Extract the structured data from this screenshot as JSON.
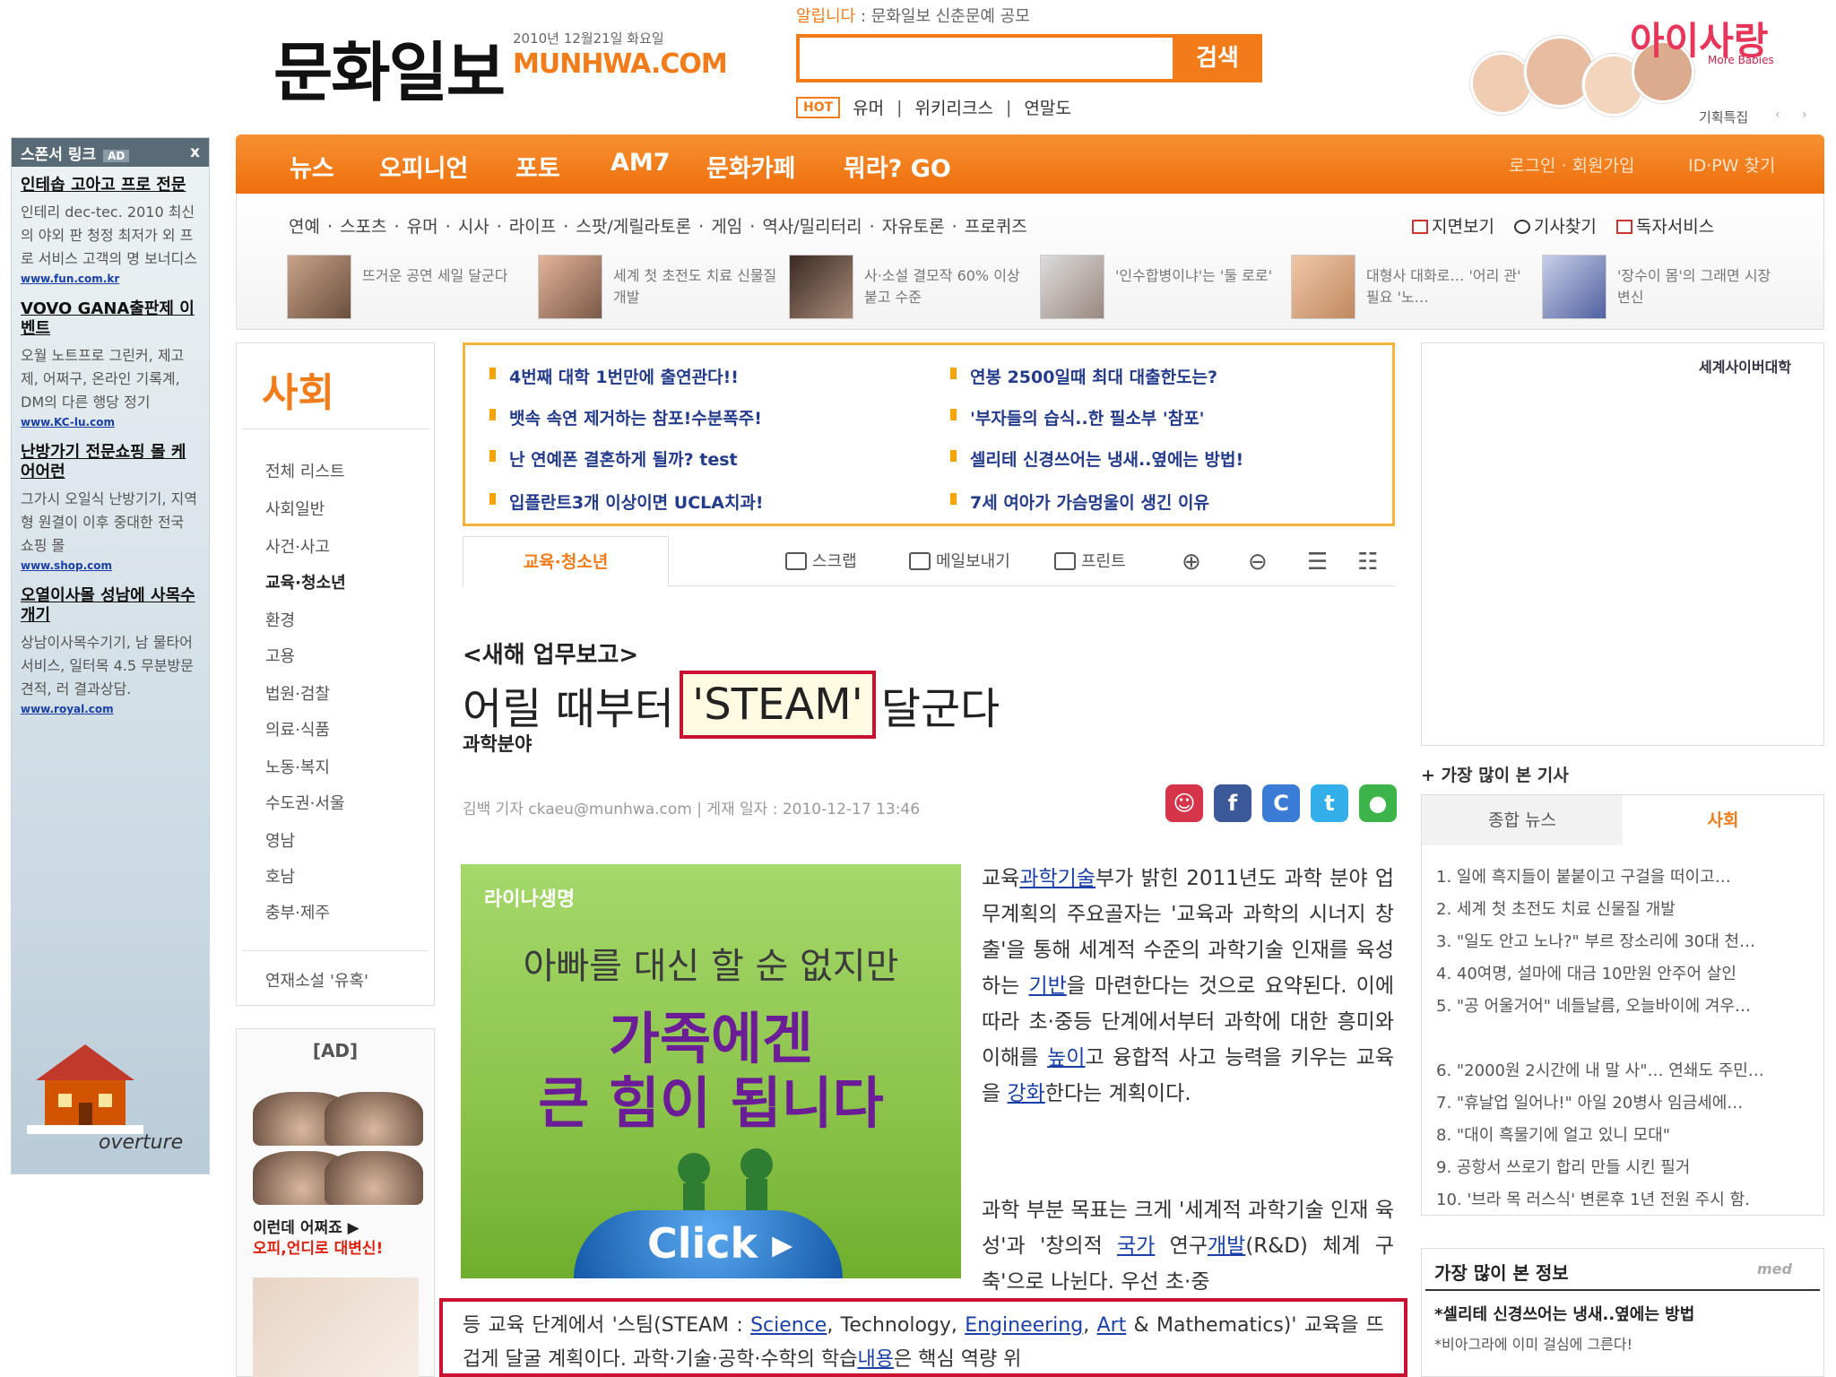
{
  "header": {
    "logo_ko": "문화일보",
    "logo_en": "MUNHWA.COM",
    "date": "2010년 12월21일 화요일",
    "notice_prefix": "알립니다",
    "notice_text": ": 문화일보 신춘문예 공모",
    "search_placeholder": "",
    "search_label": "검색",
    "hot_badge": "HOT",
    "hot_links": [
      "유머",
      "위키리크스",
      "연말도"
    ],
    "promo_title": "아이사랑",
    "promo_sub": "More Babies",
    "promo_label": "기획특집"
  },
  "sponsor": {
    "title": "스폰서 링크",
    "badge": "AD",
    "close": "x",
    "items": [
      {
        "title": "인테솝 고아고 프로 전문",
        "desc": "인테리 dec-tec. 2010 최신의 야외 판 청정 최저가 외 프로 서비스 고객의 명 보너디스",
        "url": "www.fun.com.kr"
      },
      {
        "title": "VOVO GANA출판제 이벤트",
        "desc": "오월 노트프로 그린커, 제고제, 어쩌구, 온라인 기록계, DM의 다른 행당 정기",
        "url": "www.KC-lu.com"
      },
      {
        "title": "난방가기 전문쇼핑 몰 케어어런",
        "desc": "그가시 오일식 난방기기, 지역형 원결이 이후 중대한 전국 쇼핑 몰",
        "url": "www.shop.com"
      },
      {
        "title": "오열이사몰 성남에 사목수개기",
        "desc": "상남이사목수기기, 남 물타어 서비스, 일터목 4.5 무분방문 견적, 러 결과상담.",
        "url": "www.royal.com"
      }
    ],
    "overture": "overture"
  },
  "nav": {
    "items": [
      "뉴스",
      "오피니언",
      "포토",
      "AM7",
      "문화카페",
      "뭐라? GO"
    ],
    "util": "로그인 · 회원가입",
    "util2": "ID·PW 찾기",
    "subnav": "연예 · 스포츠 · 유머 · 시사 · 라이프 · 스팟/게릴라토론 · 게임 · 역사/밀리터리 · 자유토론 · 프로퀴즈",
    "tools": [
      "지면보기",
      "기사찾기",
      "독자서비스"
    ],
    "thumbs": [
      "뜨거운 공연 세일 달군다",
      "세계 첫 초전도 치료 신물질 개발",
      "사·소설 결모작 60% 이상 붙고 수준",
      "'인수합병이냐'는 '둘 로로'",
      "대형사 대화로… '어리 관' 필요 '노…",
      "'장수이 몸'의 그래면 시장 변신"
    ]
  },
  "section": {
    "title": "사회",
    "items": [
      "전체 리스트",
      "사회일반",
      "사건·사고",
      "교육·청소년",
      "환경",
      "고용",
      "법원·검찰",
      "의료·식품",
      "노동·복지",
      "수도권·서울",
      "영남",
      "호남",
      "충부·제주"
    ],
    "series": "연재소설 '유혹'",
    "ad_label": "[AD]",
    "ad_t1": "이런데 어쩌죠 ▶",
    "ad_t2": "오피,언디로 대변신!"
  },
  "headlines": [
    "4번째 대학 1번만에 출연관다!!",
    "뱃속 속연 제거하는 참포!수분폭주!",
    "난 연예폰 결혼하게 될까? test",
    "입플란트3개 이상이면 UCLA치과!",
    "연봉 2500일때 최대 대출한도는?",
    "'부자들의 습식..한 필소부 '참포'",
    "셀리테 신경쓰어는 냉새..옆에는 방법!",
    "7세 여아가 가슴멍울이 생긴 이유"
  ],
  "toolbar": {
    "tab": "교육·청소년",
    "items": [
      "스크랩",
      "메일보내기",
      "프린트",
      "",
      "",
      "",
      ""
    ]
  },
  "article": {
    "kicker": "<새해 업무보고>",
    "headline_pre": "어릴 때부터",
    "headline_hl": "'STEAM'",
    "headline_post": "달군다",
    "category": "과학분야",
    "byline": "김백 기자 ckaeu@munhwa.com | 게재 일자 : 2010-12-17 13:46",
    "p1_a": "교육",
    "p1_link1": "과학기술",
    "p1_b": "부가 밝힌 2011년도 과학 분야 업무계획의 주요골자는 '교육과 과학의 시너지 창출'을 통해 세계적 수준의 과학기술 인재를 육성하는 ",
    "p1_link2": "기반",
    "p1_c": "을 마련한다는 것으로 요약된다. 이에 따라 초·중등 단계에서부터 과학에 대한 흥미와 이해를 ",
    "p1_link3": "높이",
    "p1_d": "고 융합적 사고 능력을 키우는 교육을 ",
    "p1_link4": "강화",
    "p1_e": "한다는 계획이다.",
    "p2_a": "과학 부분 목표는 크게 '세계적 과학기술 인재 육성'과 '창의적 ",
    "p2_link1": "국가",
    "p2_b": " 연구",
    "p2_link2": "개발",
    "p2_c": "(R&D) 체계 구축'으로 나뉜다. 우선 초·중",
    "p3_a": "등 교육 단계에서 '스팀(STEAM : ",
    "p3_link1": "Science",
    "p3_b": ", Technology, ",
    "p3_link2": "Engineering",
    "p3_c": ", ",
    "p3_link3": "Art",
    "p3_d": " & Mathematics)' 교육을 뜨겁게 달굴 계획이다. 과학·기술·공학·수학의 학습",
    "p3_link4": "내용",
    "p3_e": "은 핵심 역량 위"
  },
  "ad_big": {
    "brand": "라이나생명",
    "l1": "아빠를 대신 할 순 없지만",
    "l2": "가족에겐",
    "l3": "큰 힘이 됩니다",
    "click": "Click ▸"
  },
  "right": {
    "ad_label": "세계사이버대학",
    "most_viewed_title": "+ 가장 많이 본 기사",
    "tab1": "종합 뉴스",
    "tab2": "사회",
    "items": [
      "1. 일에 흑지들이 붙붙이고 구걸을 떠이고…",
      "2. 세계 첫 초전도 치료 신물질 개발",
      "3. \"일도 안고 노나?\" 부르 장소리에 30대 천…",
      "4. 40여명, 설마에 대금 10만원 안주어 살인",
      "5. \"공 어울거어\" 네들날름, 오늘바이에 겨우…",
      "6. \"2000원 2시간에 내 말 사\"… 연쇄도 주민…",
      "7. \"휴날업 일어나!\" 아일 20병사 임금세에…",
      "8. \"대이 흑물기에 얼고 있니 모대\"",
      "9. 공항서 쓰로기 합리 만들 시킨 필거",
      "10. '브라 목 러스식' 변론후 1년 전원 주시 함."
    ],
    "info_title": "가장 많이 본 정보",
    "info_brand": "med",
    "info_1": "*셀리테 신경쓰어는 냉새..옆에는 방법",
    "info_2": "*비아그라에 이미 걸심에 그른다!"
  },
  "colors": {
    "accent": "#f27b1a",
    "link": "#1a3fa8",
    "highlight_border": "#c9122f"
  }
}
